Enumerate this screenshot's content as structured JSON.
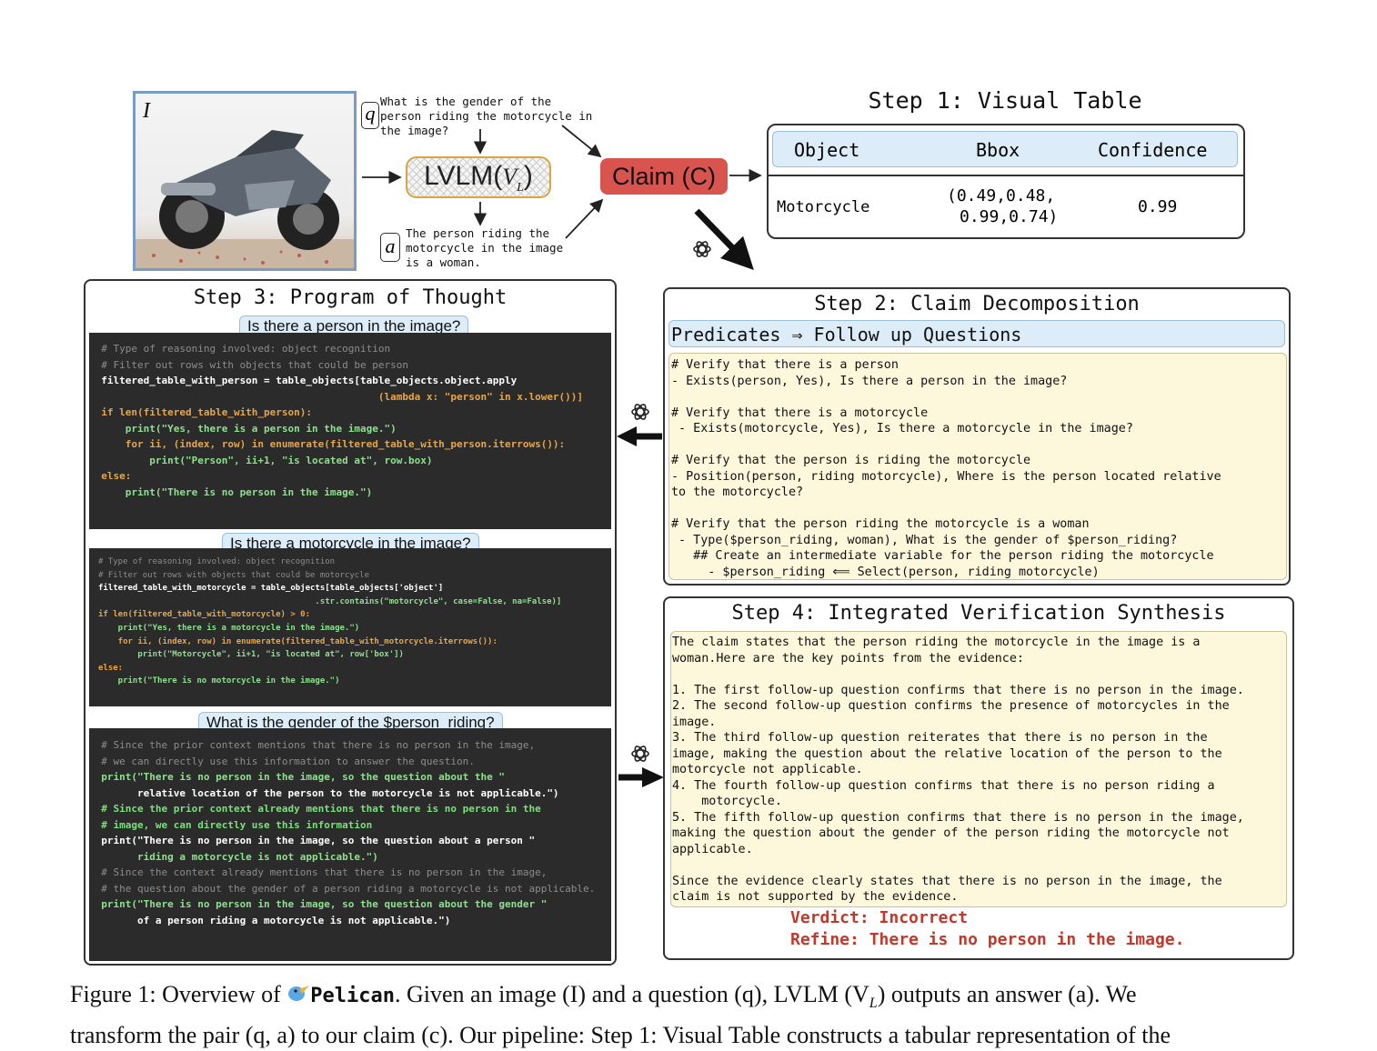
{
  "figure": {
    "image_label": "I",
    "q_label": "q",
    "a_label": "a",
    "question": [
      "What is the gender of the",
      "person riding the motorcycle in",
      "the image?"
    ],
    "answer": [
      "The person riding the",
      "motorcycle in the image",
      "is a woman."
    ],
    "lvlm_label": "LVLM(",
    "lvlm_var": "V",
    "lvlm_sub": "L",
    "lvlm_close": ")",
    "claim_label": "Claim (C)"
  },
  "step1": {
    "title": "Step 1: Visual Table",
    "headers": [
      "Object",
      "Bbox",
      "Confidence"
    ],
    "row": {
      "object": "Motorcycle",
      "bbox_line1": "(0.49,0.48,",
      "bbox_line2": "0.99,0.74)",
      "confidence": "0.99"
    }
  },
  "step2": {
    "title": "Step 2: Claim Decomposition",
    "subheader": "Predicates ⇒ Follow up Questions",
    "lines": [
      "# Verify that there is a person",
      "- Exists(person, Yes), Is there a person in the image?",
      "",
      "# Verify that there is a motorcycle",
      " - Exists(motorcycle, Yes), Is there a motorcycle in the image?",
      "",
      "# Verify that the person is riding the motorcycle",
      "- Position(person, riding motorcycle), Where is the person located relative",
      "to the motorcycle?",
      "",
      "# Verify that the person riding the motorcycle is a woman",
      " - Type($person_riding, woman), What is the gender of $person_riding?",
      "   ## Create an intermediate variable for the person riding the motorcycle",
      "     - $person_riding ⟸ Select(person, riding motorcycle)"
    ]
  },
  "step3": {
    "title": "Step 3: Program of Thought",
    "q1": "Is there a person in the image?",
    "q2": "Is there a motorcycle in the image?",
    "q3": "What is the gender of the $person_riding?",
    "code1": [
      "  # Type of reasoning involved: object recognition",
      "  # Filter out rows with objects that could be person",
      "  filtered_table_with_person = table_objects[table_objects.object.apply",
      "                                                (lambda x: \"person\" in x.lower())]",
      "",
      "  if len(filtered_table_with_person):",
      "      print(\"Yes, there is a person in the image.\")",
      "      for ii, (index, row) in enumerate(filtered_table_with_person.iterrows()):",
      "          print(\"Person\", ii+1, \"is located at\", row.box)",
      "  else:",
      "      print(\"There is no person in the image.\")"
    ],
    "code2": [
      "# Type of reasoning involved: object recognition",
      "# Filter out rows with objects that could be motorcycle",
      "filtered_table_with_motorcycle = table_objects[table_objects['object']",
      "                                            .str.contains(\"motorcycle\", case=False, na=False)]",
      "",
      "if len(filtered_table_with_motorcycle) > 0:",
      "    print(\"Yes, there is a motorcycle in the image.\")",
      "    for ii, (index, row) in enumerate(filtered_table_with_motorcycle.iterrows()):",
      "        print(\"Motorcycle\", ii+1, \"is located at\", row['box'])",
      "else:",
      "    print(\"There is no motorcycle in the image.\")"
    ],
    "code3": [
      "  # Since the prior context mentions that there is no person in the image,",
      "  # we can directly use this information to answer the question.",
      "  print(\"There is no person in the image, so the question about the \"",
      "        relative location of the person to the motorcycle is not applicable.\")",
      "",
      "  # Since the prior context already mentions that there is no person in the",
      "  # image, we can directly use this information",
      "  print(\"There is no person in the image, so the question about a person \"",
      "        riding a motorcycle is not applicable.\")",
      "",
      "  # Since the context already mentions that there is no person in the image,",
      "  # the question about the gender of a person riding a motorcycle is not applicable.",
      "  print(\"There is no person in the image, so the question about the gender \"",
      "        of a person riding a motorcycle is not applicable.\")"
    ]
  },
  "step4": {
    "title": "Step 4: Integrated Verification Synthesis",
    "lines": [
      "The claim states that the person riding the motorcycle in the image is a",
      "woman.Here are the key points from the evidence:",
      "",
      "1. The first follow-up question confirms that there is no person in the image.",
      "2. The second follow-up question confirms the presence of motorcycles in the",
      "image.",
      "3. The third follow-up question reiterates that there is no person in the",
      "image, making the question about the relative location of the person to the",
      "motorcycle not applicable.",
      "4. The fourth follow-up question confirms that there is no person riding a",
      "    motorcycle.",
      "5. The fifth follow-up question confirms that there is no person in the image,",
      "making the question about the gender of the person riding the motorcycle not",
      "applicable.",
      "",
      "Since the evidence clearly states that there is no person in the image, the",
      "claim is not supported by the evidence."
    ],
    "verdict": "Verdict: Incorrect",
    "refine": "Refine: There is no person in the image."
  },
  "caption": {
    "prefix": "Figure 1: Overview of ",
    "name": "Pelican",
    "line1_rest": ". Given an image (I) and a question (q), LVLM (V",
    "line1_sub": "L",
    "line1_end": ") outputs an answer (a). We",
    "line2": "transform the pair (q, a) to our claim (c). Our pipeline: Step 1: Visual Table constructs a tabular representation of the"
  },
  "colors": {
    "claim": "#d9534f",
    "lvlm_border": "#d9a441",
    "pill": "#dcecf8",
    "yellow": "#fdf7dc",
    "verdict": "#c0392b",
    "code_bg": "#2b2b2b"
  }
}
